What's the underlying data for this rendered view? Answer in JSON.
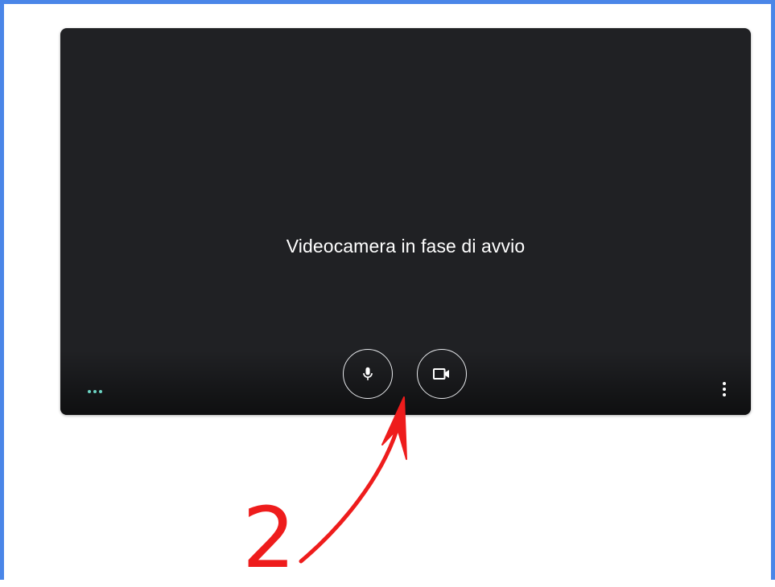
{
  "preview": {
    "status_text": "Videocamera in fase di avvio",
    "buttons": {
      "mic_icon": "microphone-icon",
      "camera_icon": "video-camera-icon",
      "more_icon": "more-vert-icon"
    },
    "indicator_icon": "audio-level-dots-icon"
  },
  "annotation": {
    "number": "2"
  },
  "colors": {
    "frame_border": "#4a86e8",
    "preview_bg": "#202124",
    "annotation_red": "#ee1c1c",
    "indicator_teal": "#6dd5c4"
  }
}
